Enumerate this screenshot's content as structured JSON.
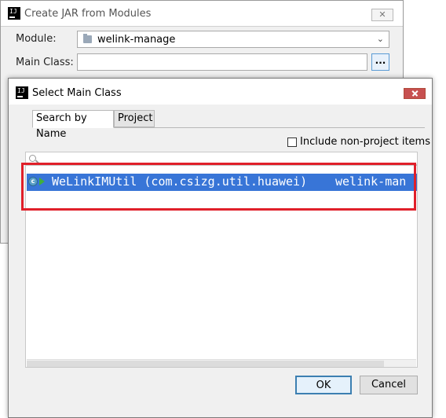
{
  "background_dialog": {
    "title": "Create JAR from Modules",
    "close_label": "✕",
    "module_label": "Module:",
    "module_value": "welink-manage",
    "main_class_label": "Main Class:",
    "main_class_value": "",
    "browse_label": "..."
  },
  "select_dialog": {
    "title": "Select Main Class",
    "tabs": [
      {
        "label": "Search by Name"
      },
      {
        "label": "Project"
      }
    ],
    "include_label": "Include non-project items",
    "include_checked": false,
    "search_value": "",
    "results": [
      {
        "text": "WeLinkIMUtil (com.csizg.util.huawei)",
        "module": "welink-man"
      }
    ],
    "ok_label": "OK",
    "cancel_label": "Cancel"
  },
  "icons": {
    "app": "intellij-logo-icon",
    "module": "folder-icon",
    "search": "search-icon",
    "class": "class-icon",
    "run": "run-icon",
    "dropdown": "chevron-down-icon"
  },
  "colors": {
    "selection": "#3875d7",
    "annotation": "#e0202a",
    "close_active": "#c75050"
  }
}
